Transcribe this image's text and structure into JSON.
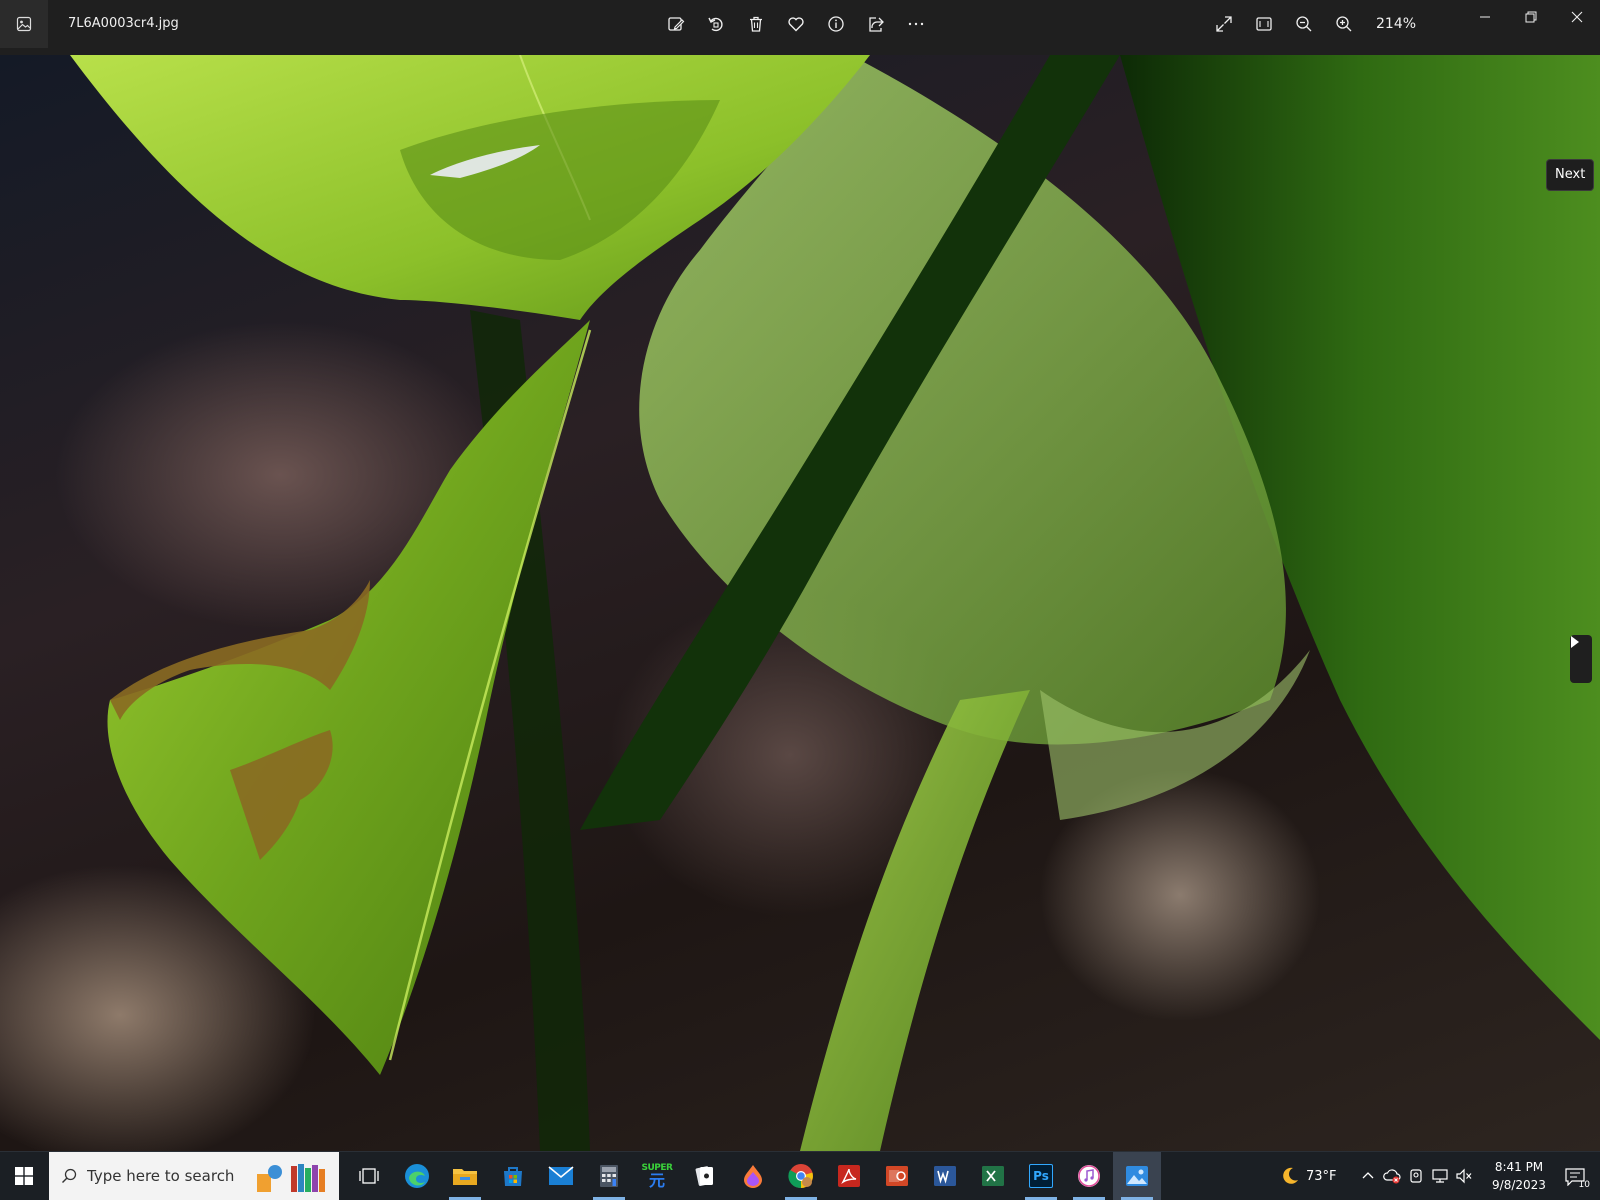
{
  "window": {
    "file_name": "7L6A0003cr4.jpg",
    "app_icon": "photos-app-icon"
  },
  "toolbar": {
    "items": [
      {
        "name": "edit-image-icon"
      },
      {
        "name": "rotate-icon"
      },
      {
        "name": "delete-icon"
      },
      {
        "name": "favorite-icon"
      },
      {
        "name": "info-icon"
      },
      {
        "name": "share-icon"
      },
      {
        "name": "more-icon"
      }
    ],
    "zoom_level": "214%"
  },
  "viewer": {
    "next_tooltip": "Next"
  },
  "taskbar": {
    "search_placeholder": "Type here to search",
    "apps": [
      "task-view",
      "edge",
      "file-explorer",
      "microsoft-store",
      "mail",
      "calculator",
      "super-app",
      "solitaire",
      "paint-3d",
      "chrome",
      "acrobat",
      "powerpoint",
      "word",
      "excel",
      "photoshop",
      "itunes",
      "photos"
    ],
    "super_label": "SUPER",
    "ps_label": "Ps",
    "weather_temp": "73°F",
    "time": "8:41 PM",
    "date": "9/8/2023",
    "notification_count": "10"
  },
  "colors": {
    "leaf_light": "#9ccd2e",
    "leaf_dark": "#4f7f12",
    "stem": "#0f2a0a",
    "taskbar": "#1b1f24",
    "titlebar": "#1f1f1f"
  }
}
